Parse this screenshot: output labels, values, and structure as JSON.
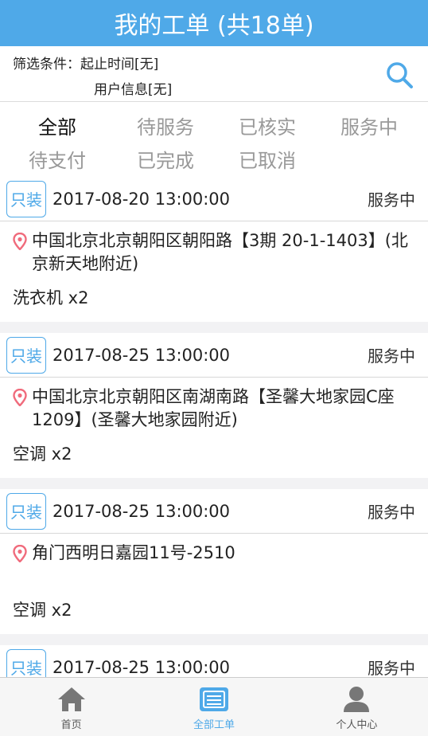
{
  "header": {
    "title": "我的工单 (共18单)"
  },
  "filter": {
    "label": "筛选条件：",
    "time_text": "起止时间[无]",
    "user_text": "用户信息[无]"
  },
  "tabs": {
    "row1": [
      "全部",
      "待服务",
      "已核实",
      "服务中"
    ],
    "row2": [
      "待支付",
      "已完成",
      "已取消"
    ],
    "active": "全部"
  },
  "orders": [
    {
      "tag": "只装",
      "time": "2017-08-20 13:00:00",
      "status": "服务中",
      "address": "中国北京北京朝阳区朝阳路【3期 20-1-1403】(北京新天地附近)",
      "item": "洗衣机  x2"
    },
    {
      "tag": "只装",
      "time": "2017-08-25 13:00:00",
      "status": "服务中",
      "address": "中国北京北京朝阳区南湖南路【圣馨大地家园C座1209】(圣馨大地家园附近)",
      "item": "空调  x2"
    },
    {
      "tag": "只装",
      "time": "2017-08-25 13:00:00",
      "status": "服务中",
      "address": "角门西明日嘉园11号-2510",
      "item": "空调  x2"
    },
    {
      "tag": "只装",
      "time": "2017-08-25 13:00:00",
      "status": "服务中",
      "address": "",
      "item": ""
    }
  ],
  "nav": [
    {
      "label": "首页",
      "icon": "home-icon"
    },
    {
      "label": "全部工单",
      "icon": "work-order-icon",
      "active": true
    },
    {
      "label": "个人中心",
      "icon": "person-icon"
    }
  ],
  "colors": {
    "accent": "#4fa9e8",
    "pin": "#f06b7c"
  }
}
